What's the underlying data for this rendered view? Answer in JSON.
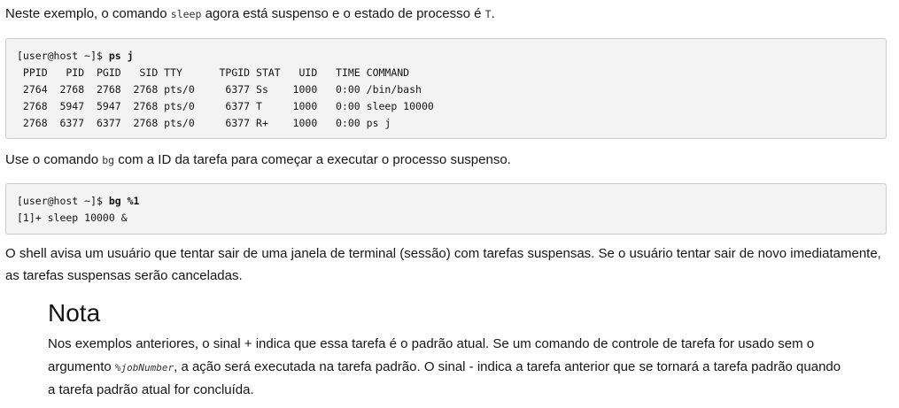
{
  "para1": {
    "before": "Neste exemplo, o comando ",
    "code": "sleep",
    "middle": " agora está suspenso e o estado de processo é ",
    "code2": "T",
    "after": "."
  },
  "code1": {
    "prompt": "[user@host ~]$ ",
    "command": "ps j",
    "lines": [
      " PPID   PID  PGID   SID TTY      TPGID STAT   UID   TIME COMMAND",
      " 2764  2768  2768  2768 pts/0     6377 Ss    1000   0:00 /bin/bash",
      " 2768  5947  5947  2768 pts/0     6377 T     1000   0:00 sleep 10000",
      " 2768  6377  6377  2768 pts/0     6377 R+    1000   0:00 ps j"
    ]
  },
  "para2": {
    "before": "Use o comando ",
    "code": "bg",
    "after": " com a ID da tarefa para começar a executar o processo suspenso."
  },
  "code2": {
    "prompt": "[user@host ~]$ ",
    "command": "bg %1",
    "lines": [
      "[1]+ sleep 10000 &"
    ]
  },
  "para3": "O shell avisa um usuário que tentar sair de uma janela de terminal (sessão) com tarefas suspensas. Se o usuário tentar sair de novo imediatamente, as tarefas suspensas serão canceladas.",
  "note": {
    "title": "Nota",
    "before": "Nos exemplos anteriores, o sinal + indica que essa tarefa é o padrão atual. Se um comando de controle de tarefa for usado sem o argumento ",
    "code": "%jobNumber",
    "after": ", a ação será executada na tarefa padrão. O sinal - indica a tarefa anterior que se tornará a tarefa padrão quando a tarefa padrão atual for concluída."
  }
}
